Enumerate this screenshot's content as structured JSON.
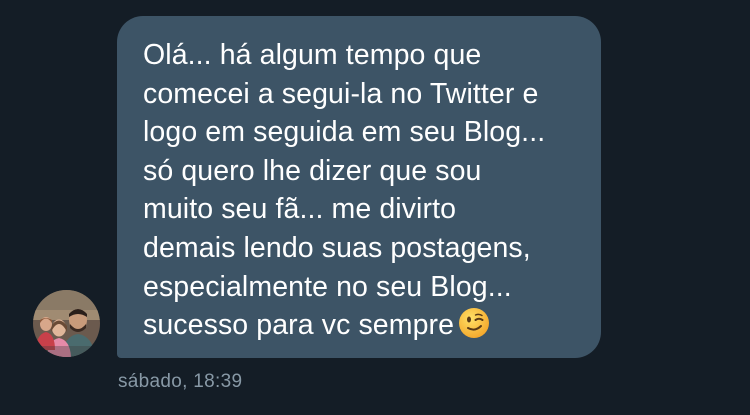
{
  "conversation": {
    "message": {
      "text": "Olá... há algum tempo que\ncomecei a segui-la no Twitter e\nlogo em seguida em seu Blog...\nsó quero lhe dizer que sou\nmuito seu fã... me divirto\ndemais lendo suas postagens,\nespecialmente no seu Blog...\nsucesso para vc sempre",
      "emoji": "winking-face-emoji",
      "timestamp": "sábado, 18:39"
    },
    "sender": {
      "avatar_icon": "profile-photo"
    }
  },
  "colors": {
    "background": "#141d26",
    "bubble": "#3d5466",
    "message_text": "#ffffff",
    "timestamp_text": "#8899a6"
  }
}
